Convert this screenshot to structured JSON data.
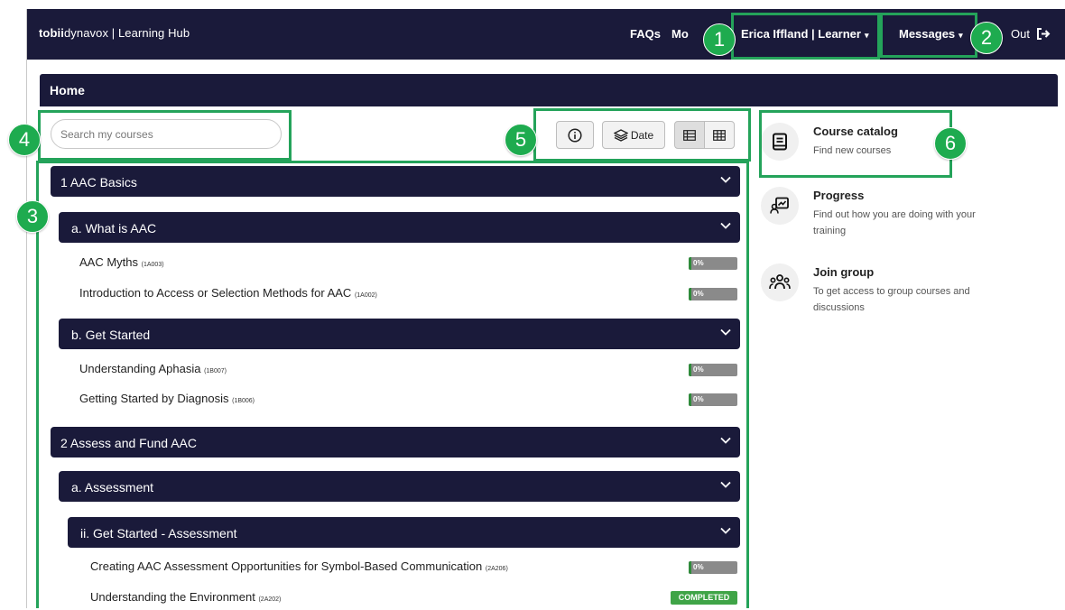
{
  "brand": {
    "bold": "tobii",
    "rest": "dynavox | Learning Hub"
  },
  "nav": {
    "faqs": "FAQs",
    "more_partial": "Mo",
    "user": "Erica Iffland | Learner",
    "messages": "Messages",
    "logout_partial": "Out"
  },
  "home": {
    "title": "Home"
  },
  "search": {
    "placeholder": "Search my courses"
  },
  "toolbar": {
    "date_label": "Date"
  },
  "categories": [
    {
      "label": "1 AAC Basics"
    },
    {
      "label": "a. What is AAC"
    },
    {
      "label": "b. Get Started"
    },
    {
      "label": "2 Assess and Fund AAC"
    },
    {
      "label": "a. Assessment"
    },
    {
      "label": "ii. Get Started - Assessment"
    }
  ],
  "courses": [
    {
      "title": "AAC Myths",
      "code": "(1A003)",
      "progress_percent": 0,
      "progress": "0%"
    },
    {
      "title": "Introduction to Access or Selection Methods for AAC",
      "code": "(1A002)",
      "progress_percent": 0,
      "progress": "0%"
    },
    {
      "title": "Understanding Aphasia",
      "code": "(1B007)",
      "progress_percent": 0,
      "progress": "0%"
    },
    {
      "title": "Getting Started by Diagnosis",
      "code": "(1B006)",
      "progress_percent": 0,
      "progress": "0%"
    },
    {
      "title": "Creating AAC Assessment Opportunities for Symbol-Based Communication",
      "code": "(2A206)",
      "progress_percent": 0,
      "progress": "0%"
    },
    {
      "title": "Understanding the Environment",
      "code": "(2A202)",
      "status": "COMPLETED"
    }
  ],
  "sidebar": {
    "catalog": {
      "title": "Course catalog",
      "desc": "Find new courses"
    },
    "progress": {
      "title": "Progress",
      "desc": "Find out how you are doing with your training"
    },
    "join": {
      "title": "Join group",
      "desc": "To get access to group courses and discussions"
    }
  },
  "callouts": [
    "1",
    "2",
    "3",
    "4",
    "5",
    "6"
  ],
  "colors": {
    "navy": "#1a1a3a",
    "highlight": "#24a35a",
    "callout": "#1eab4f",
    "completed": "#3fa447"
  }
}
